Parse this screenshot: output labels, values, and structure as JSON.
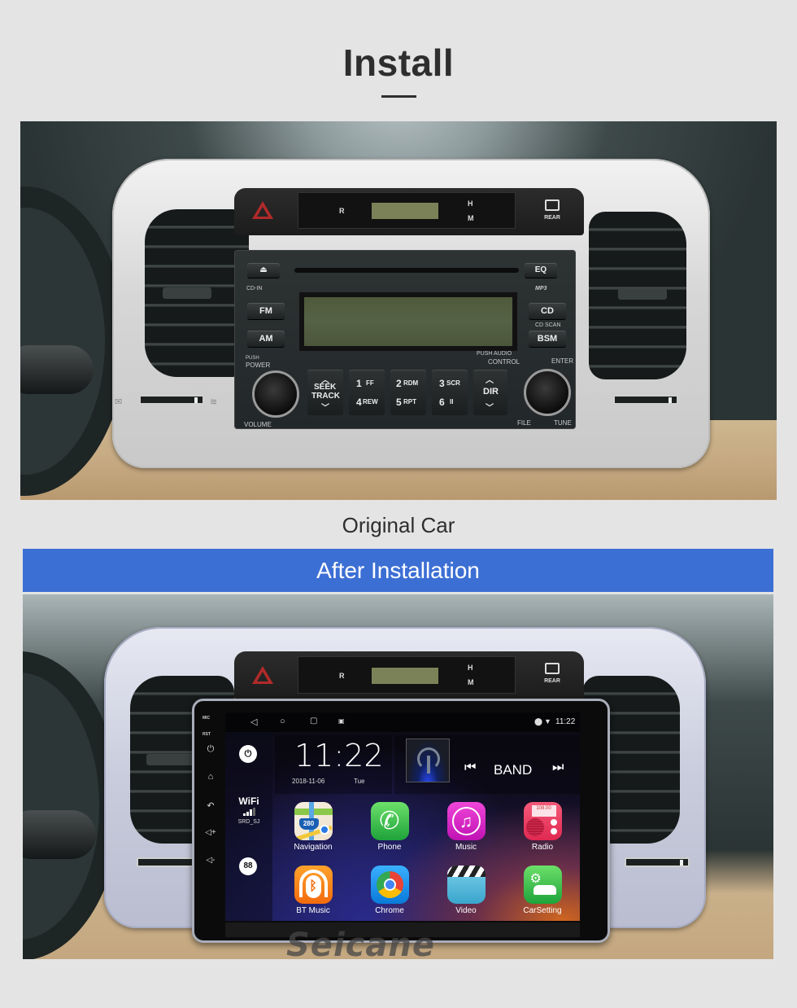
{
  "header": {
    "title": "Install"
  },
  "original": {
    "caption": "Original Car",
    "clock_panel": {
      "labels": [
        "R",
        "H",
        "M"
      ],
      "rear_defrost_label": "REAR"
    },
    "radio": {
      "eject_label": "⏏",
      "eq_label": "EQ",
      "cd_in_label": "CD-IN",
      "mp3_label": "MP3",
      "fm_label": "FM",
      "am_label": "AM",
      "cd_label": "CD",
      "cd_scan_label": "CD SCAN",
      "bsm_label": "BSM",
      "push_power_label": "PUSH",
      "power_label": "POWER",
      "volume_label": "VOLUME",
      "push_audio_label": "PUSH AUDIO",
      "control_label": "CONTROL",
      "enter_label": "ENTER",
      "file_label": "FILE",
      "tune_label": "TUNE",
      "seek_label": "SEEK",
      "track_label": "TRACK",
      "dir_label": "DIR",
      "presets": [
        {
          "top": "1",
          "top_sub": "FF",
          "bottom": "4",
          "bottom_sub": "REW"
        },
        {
          "top": "2",
          "top_sub": "RDM",
          "bottom": "5",
          "bottom_sub": "RPT"
        },
        {
          "top": "3",
          "top_sub": "SCR",
          "bottom": "6",
          "bottom_sub": "II"
        }
      ]
    }
  },
  "after": {
    "banner": "After  Installation",
    "unit": {
      "side_labels": {
        "mic": "MIC",
        "rst": "RST"
      },
      "side_icons": [
        "power-icon",
        "home-icon",
        "back-icon",
        "volume-up-icon",
        "volume-down-icon"
      ],
      "status_bar": {
        "nav_icons": [
          "back-icon",
          "home-icon",
          "recents-icon",
          "screenshot-icon"
        ],
        "time": "11:22"
      },
      "wifi": {
        "title": "WiFi",
        "ssid": "SRD_SJ",
        "signal_bars": 3,
        "signal_max": 4
      },
      "clock": {
        "time": "11:22",
        "date": "2018-11-06",
        "day": "Tue"
      },
      "radio_widget": {
        "band_label": "BAND",
        "prev_icon": "skip-previous-icon",
        "next_icon": "skip-next-icon"
      },
      "apps": [
        {
          "label": "Navigation",
          "icon": "navigation-icon",
          "shield": "280"
        },
        {
          "label": "Phone",
          "icon": "phone-icon"
        },
        {
          "label": "Music",
          "icon": "music-icon"
        },
        {
          "label": "Radio",
          "icon": "radio-icon",
          "display": "108.00"
        },
        {
          "label": "BT Music",
          "icon": "bt-music-icon"
        },
        {
          "label": "Chrome",
          "icon": "chrome-icon"
        },
        {
          "label": "Video",
          "icon": "video-icon"
        },
        {
          "label": "CarSetting",
          "icon": "car-setting-icon"
        }
      ]
    },
    "watermark": "Seicane"
  },
  "colors": {
    "banner_bg": "#3c6fd4",
    "page_bg": "#e4e4e4",
    "title_text": "#2e2e2e"
  }
}
